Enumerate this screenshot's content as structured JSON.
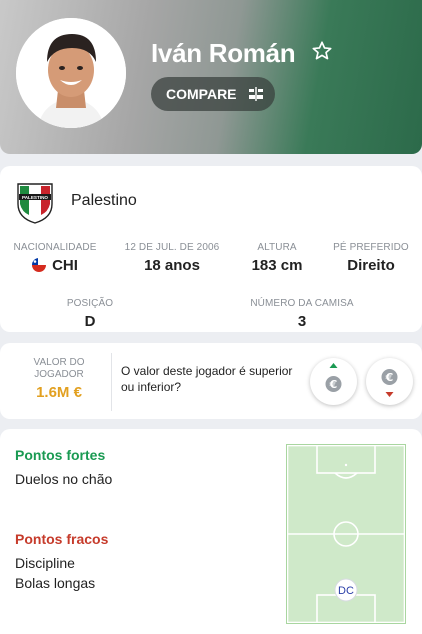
{
  "player": {
    "name": "Iván Román",
    "compare_label": "COMPARE"
  },
  "club": {
    "name": "Palestino"
  },
  "stats": {
    "nationality": {
      "label": "NACIONALIDADE",
      "value": "CHI"
    },
    "birth": {
      "label": "12 DE JUL. DE 2006",
      "value": "18 anos"
    },
    "height": {
      "label": "ALTURA",
      "value": "183 cm"
    },
    "foot": {
      "label": "PÉ PREFERIDO",
      "value": "Direito"
    },
    "position": {
      "label": "POSIÇÃO",
      "value": "D"
    },
    "shirt": {
      "label": "NÚMERO DA CAMISA",
      "value": "3"
    }
  },
  "market_value": {
    "label": "VALOR DO JOGADOR",
    "value": "1.6M €",
    "question": "O valor deste jogador é superior ou inferior?"
  },
  "attributes": {
    "strengths_title": "Pontos fortes",
    "strengths": [
      "Duelos no chão"
    ],
    "weaknesses_title": "Pontos fracos",
    "weaknesses": [
      "Discipline",
      "Bolas longas"
    ]
  },
  "pitch": {
    "position_badge": "DC"
  },
  "colors": {
    "strengths": "#1a9a52",
    "weaknesses": "#c63b2b",
    "market_value": "#e2a020",
    "header_green": "#2c6a4a"
  }
}
